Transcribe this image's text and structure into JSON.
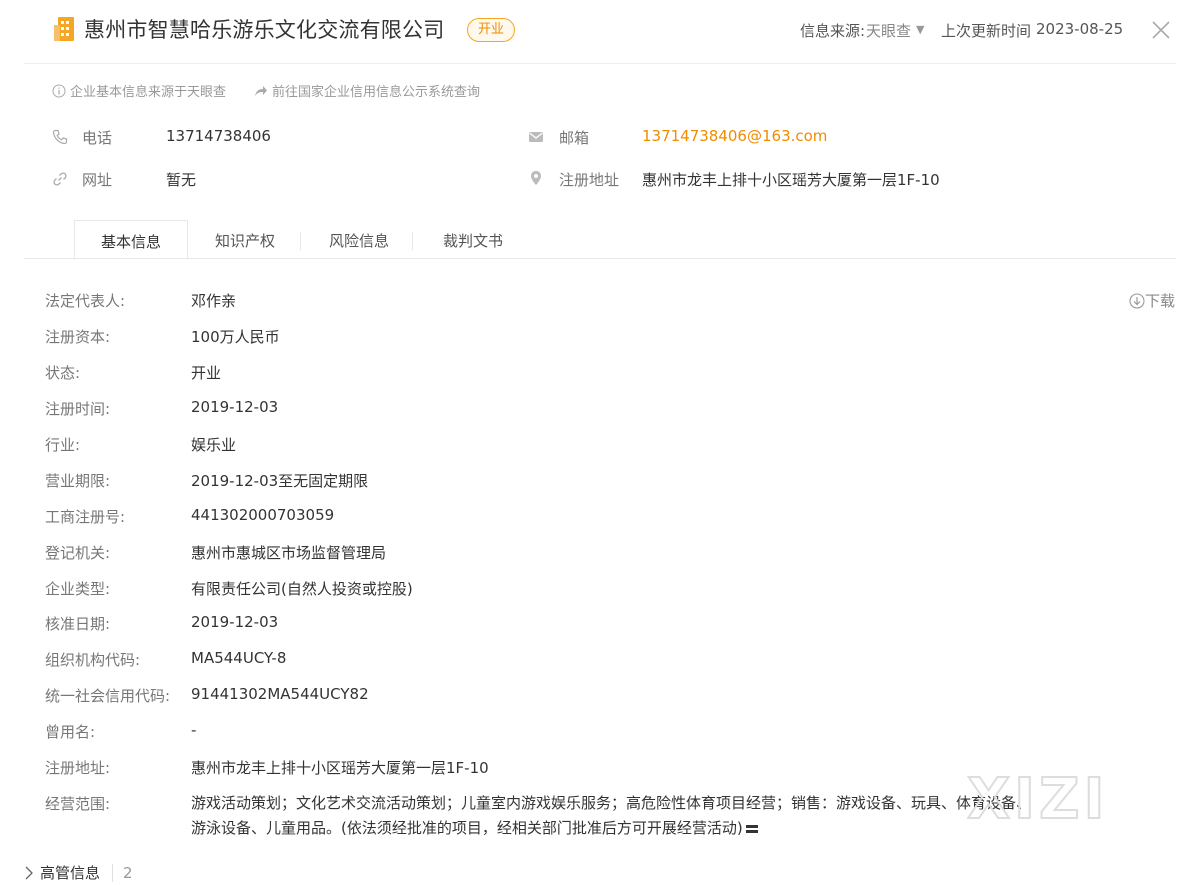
{
  "header": {
    "company_name": "惠州市智慧哈乐游乐文化交流有限公司",
    "status_badge": "开业",
    "source_label": "信息来源:",
    "source_value": "天眼查",
    "update_label": "上次更新时间",
    "update_value": "2023-08-25",
    "accent_color": "#f08c00"
  },
  "hints": {
    "source_note": "企业基本信息来源于天眼查",
    "gov_link": "前往国家企业信用信息公示系统查询"
  },
  "contact": {
    "phone_label": "电话",
    "phone_value": "13714738406",
    "email_label": "邮箱",
    "email_value": "13714738406@163.com",
    "website_label": "网址",
    "website_value": "暂无",
    "address_label": "注册地址",
    "address_value": "惠州市龙丰上排十小区瑶芳大厦第一层1F-10"
  },
  "tabs": [
    {
      "label": "基本信息",
      "active": true
    },
    {
      "label": "知识产权"
    },
    {
      "label": "风险信息"
    },
    {
      "label": "裁判文书"
    }
  ],
  "download_label": "下载",
  "details": [
    {
      "key": "法定代表人:",
      "value": "邓作亲"
    },
    {
      "key": "注册资本:",
      "value": "100万人民币"
    },
    {
      "key": "状态:",
      "value": "开业"
    },
    {
      "key": "注册时间:",
      "value": "2019-12-03"
    },
    {
      "key": "行业:",
      "value": "娱乐业"
    },
    {
      "key": "营业期限:",
      "value": "2019-12-03至无固定期限"
    },
    {
      "key": "工商注册号:",
      "value": "441302000703059"
    },
    {
      "key": "登记机关:",
      "value": "惠州市惠城区市场监督管理局"
    },
    {
      "key": "企业类型:",
      "value": "有限责任公司(自然人投资或控股)"
    },
    {
      "key": "核准日期:",
      "value": "2019-12-03"
    },
    {
      "key": "组织机构代码:",
      "value": "MA544UCY-8"
    },
    {
      "key": "统一社会信用代码:",
      "value": "91441302MA544UCY82"
    },
    {
      "key": "曾用名:",
      "value": "-"
    },
    {
      "key": "注册地址:",
      "value": "惠州市龙丰上排十小区瑶芳大厦第一层1F-10"
    }
  ],
  "scope": {
    "key": "经营范围:",
    "value": "游戏活动策划；文化艺术交流活动策划；儿童室内游戏娱乐服务；高危险性体育项目经营；销售：游戏设备、玩具、体育设备、游泳设备、儿童用品。(依法须经批准的项目，经相关部门批准后方可开展经营活动)"
  },
  "watermark_text": "XIZI",
  "section": {
    "label": "高管信息",
    "count": "2"
  }
}
